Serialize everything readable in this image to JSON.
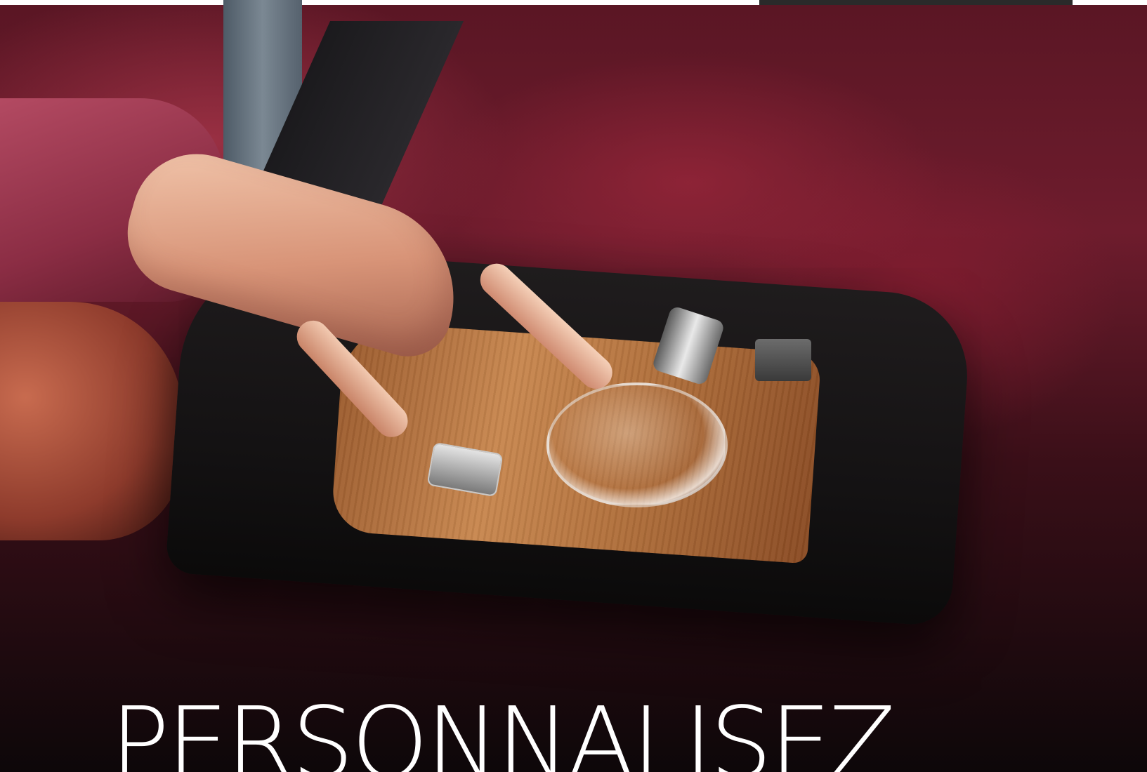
{
  "headline": {
    "text": "PERSONNALISEZ"
  },
  "colors": {
    "headline_text": "#ffffff",
    "top_bar": "#ffffff",
    "top_bar_accent": "#2a2a2a",
    "fabric_red": "#8b2d44",
    "wood": "#b3723d"
  }
}
